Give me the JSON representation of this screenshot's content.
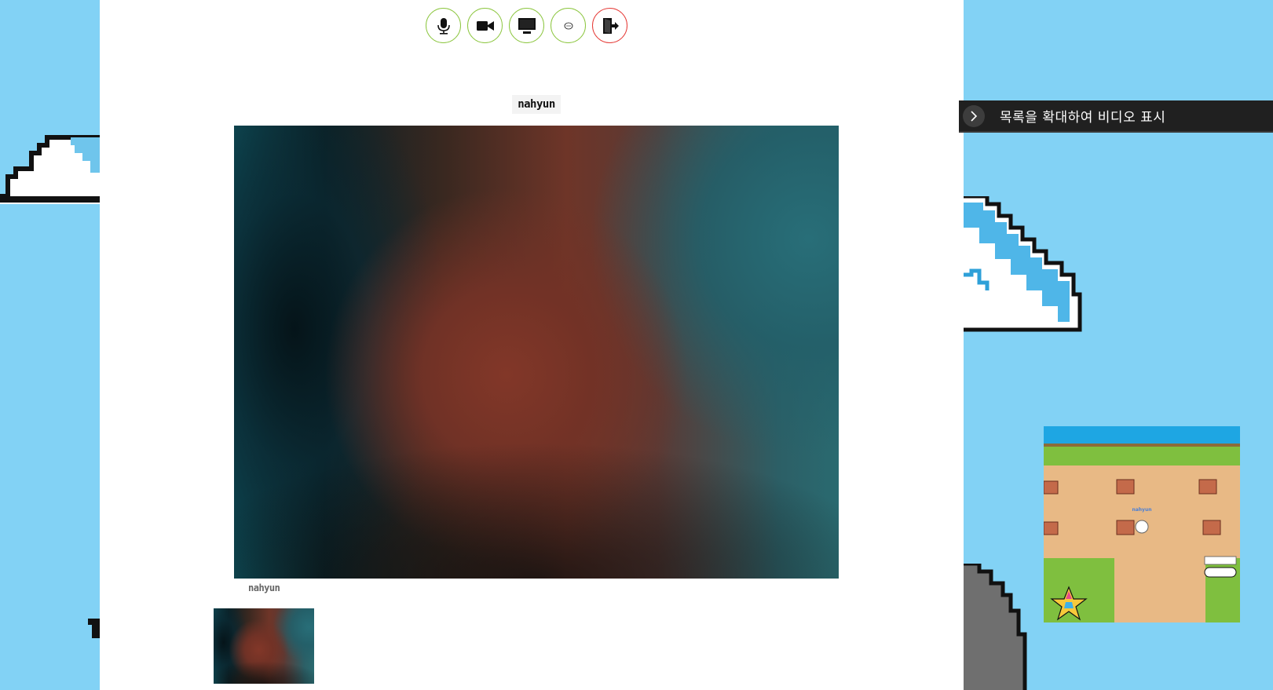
{
  "toolbar": {
    "mic": "mic-icon",
    "camera": "camera-icon",
    "screen": "screen-share-icon",
    "chat": "chat-icon",
    "leave": "exit-icon",
    "colors": {
      "accent": "#8cc63f",
      "leave": "#e53935"
    }
  },
  "main_video": {
    "participant_name": "nahyun"
  },
  "thumbnail": {
    "participant_name": "nahyun"
  },
  "tooltip": {
    "text": "목록을 확대하여 비디오 표시",
    "icon": "chevron-right-icon"
  },
  "minimap": {
    "player_name": "nahyun"
  },
  "colors": {
    "sky": "#82d2f5",
    "panel": "#ffffff"
  }
}
